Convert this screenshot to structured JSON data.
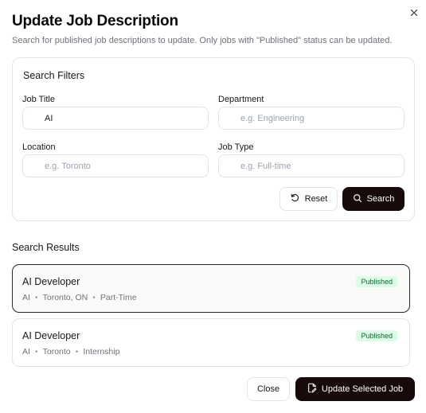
{
  "dialog": {
    "title": "Update Job Description",
    "subtitle": "Search for published job descriptions to update. Only jobs with \"Published\" status can be updated."
  },
  "filters": {
    "title": "Search Filters",
    "job_title": {
      "label": "Job Title",
      "value": "AI",
      "placeholder": ""
    },
    "department": {
      "label": "Department",
      "value": "",
      "placeholder": "e.g. Engineering"
    },
    "location": {
      "label": "Location",
      "value": "",
      "placeholder": "e.g. Toronto"
    },
    "job_type": {
      "label": "Job Type",
      "value": "",
      "placeholder": "e.g. Full-time"
    },
    "reset_label": "Reset",
    "search_label": "Search"
  },
  "results": {
    "title": "Search Results",
    "items": [
      {
        "title": "AI Developer",
        "department": "AI",
        "location": "Toronto, ON",
        "type": "Part-Time",
        "status": "Published",
        "selected": true
      },
      {
        "title": "AI Developer",
        "department": "AI",
        "location": "Toronto",
        "type": "Internship",
        "status": "Published",
        "selected": false
      }
    ]
  },
  "footer": {
    "close_label": "Close",
    "update_label": "Update Selected Job"
  },
  "colors": {
    "primary": "#18090a",
    "badge_bg": "#dcfce7",
    "badge_text": "#166534",
    "border": "#e4e4e7",
    "muted_text": "#71717a"
  },
  "icons": {
    "close": "close-icon",
    "reset": "rotate-ccw-icon",
    "search": "search-icon",
    "update": "file-edit-icon"
  }
}
